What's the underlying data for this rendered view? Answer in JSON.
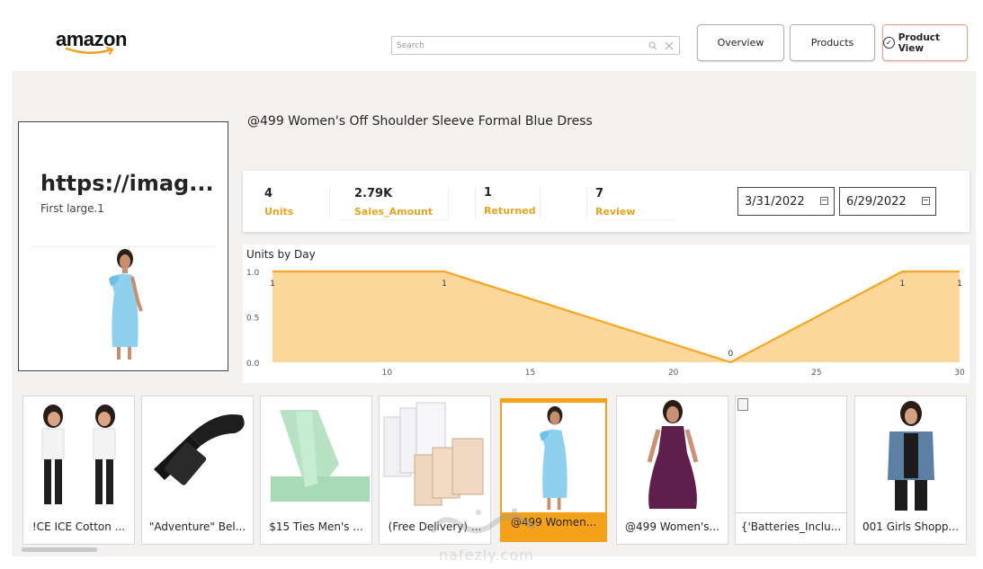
{
  "header": {
    "logo_text": "amazon",
    "search": {
      "placeholder": "Search",
      "value": ""
    },
    "nav": [
      {
        "label": "Overview"
      },
      {
        "label": "Products"
      },
      {
        "label": "Product View",
        "active": true
      }
    ]
  },
  "image_card": {
    "url_text": "https://imag...",
    "subtitle": "First large.1"
  },
  "product_title": "@499 Women's Off Shoulder Sleeve Formal Blue Dress",
  "kpis": [
    {
      "value": "4",
      "label": "Units"
    },
    {
      "value": "2.79K",
      "label": "Sales_Amount"
    },
    {
      "value": "1",
      "label": "Returned"
    },
    {
      "value": "7",
      "label": "Review"
    }
  ],
  "date_range": {
    "start": "3/31/2022",
    "end": "6/29/2022"
  },
  "chart_data": {
    "type": "area",
    "title": "Units by Day",
    "x": [
      6,
      12,
      22,
      28,
      30
    ],
    "values": [
      1,
      1,
      0,
      1,
      1
    ],
    "data_labels": [
      "1",
      "1",
      "0",
      "1",
      "1"
    ],
    "xticks": [
      "10",
      "15",
      "20",
      "25",
      "30"
    ],
    "xtick_values": [
      10,
      15,
      20,
      25,
      30
    ],
    "yticks": [
      "1.0",
      "0.5",
      "0.0"
    ],
    "xlim": [
      6,
      30
    ],
    "ylim": [
      0,
      1
    ],
    "colors": {
      "line": "#f5a623",
      "fill": "#fbd79b"
    }
  },
  "products": [
    {
      "caption": "!CE ICE Cotton ..."
    },
    {
      "caption": "\"Adventure\" Bel..."
    },
    {
      "caption": "$15 Ties Men's ..."
    },
    {
      "caption": "(Free Delivery) ..."
    },
    {
      "caption": "@499 Women...",
      "selected": true
    },
    {
      "caption": "@499 Women's..."
    },
    {
      "caption": "{'Batteries_Inclu..."
    },
    {
      "caption": "001 Girls Shopp..."
    }
  ],
  "watermark": {
    "text": "nafezly.com"
  },
  "colors": {
    "accent": "#f6a11a",
    "kpi_label": "#e8a31f"
  }
}
